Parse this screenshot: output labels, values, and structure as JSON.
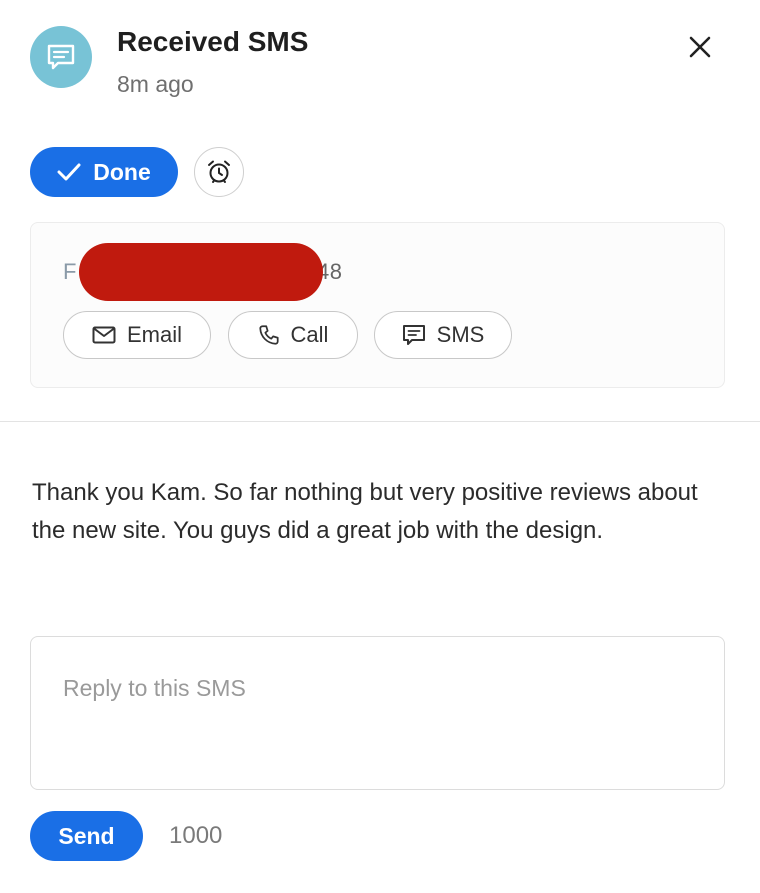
{
  "header": {
    "title": "Received SMS",
    "time": "8m ago",
    "icon": "sms-message-icon",
    "accent_color": "#78c3d6"
  },
  "toolbar": {
    "done_label": "Done",
    "snooze_icon": "alarm-clock-icon",
    "primary_color": "#1a6fe6"
  },
  "contact": {
    "from_prefix": "F",
    "from_suffix": "48",
    "redaction_color": "#c01a0e",
    "actions": [
      {
        "label": "Email",
        "icon": "envelope-icon"
      },
      {
        "label": "Call",
        "icon": "phone-icon"
      },
      {
        "label": "SMS",
        "icon": "sms-icon"
      }
    ]
  },
  "message": {
    "body": "Thank you Kam. So far nothing but very positive reviews about the new site. You guys did a great job with the design."
  },
  "reply": {
    "placeholder": "Reply to this SMS",
    "value": "",
    "send_label": "Send",
    "char_count": "1000"
  }
}
